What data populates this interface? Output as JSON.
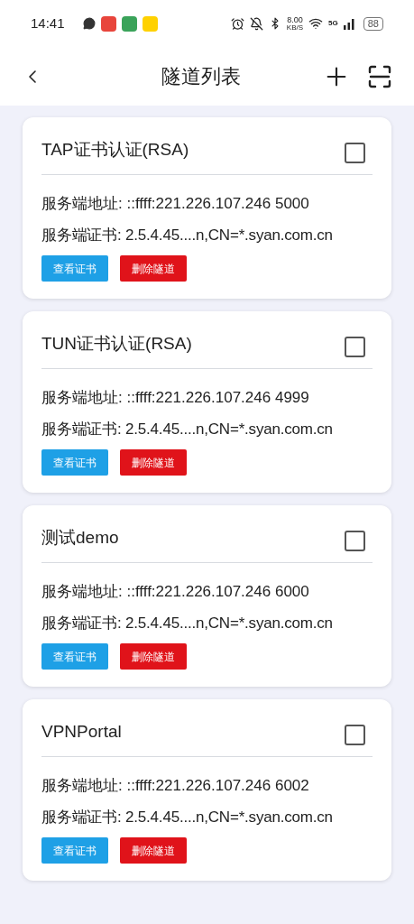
{
  "status_bar": {
    "time": "14:41",
    "speed": "8.00",
    "speed_unit": "KB/S",
    "network": "5G",
    "battery": "88"
  },
  "header": {
    "title": "隧道列表"
  },
  "tunnels": [
    {
      "name": "TAP证书认证(RSA)",
      "checked": false,
      "address": "服务端地址: ::ffff:221.226.107.246 5000",
      "certificate": "服务端证书: 2.5.4.45....n,CN=*.syan.com.cn",
      "view_button": "查看证书",
      "delete_button": "删除隧道"
    },
    {
      "name": "TUN证书认证(RSA)",
      "checked": false,
      "address": "服务端地址: ::ffff:221.226.107.246 4999",
      "certificate": "服务端证书: 2.5.4.45....n,CN=*.syan.com.cn",
      "view_button": "查看证书",
      "delete_button": "删除隧道"
    },
    {
      "name": "测试demo",
      "checked": false,
      "address": "服务端地址: ::ffff:221.226.107.246 6000",
      "certificate": "服务端证书: 2.5.4.45....n,CN=*.syan.com.cn",
      "view_button": "查看证书",
      "delete_button": "删除隧道"
    },
    {
      "name": "VPNPortal",
      "checked": false,
      "address": "服务端地址: ::ffff:221.226.107.246 6002",
      "certificate": "服务端证书: 2.5.4.45....n,CN=*.syan.com.cn",
      "view_button": "查看证书",
      "delete_button": "删除隧道"
    }
  ]
}
